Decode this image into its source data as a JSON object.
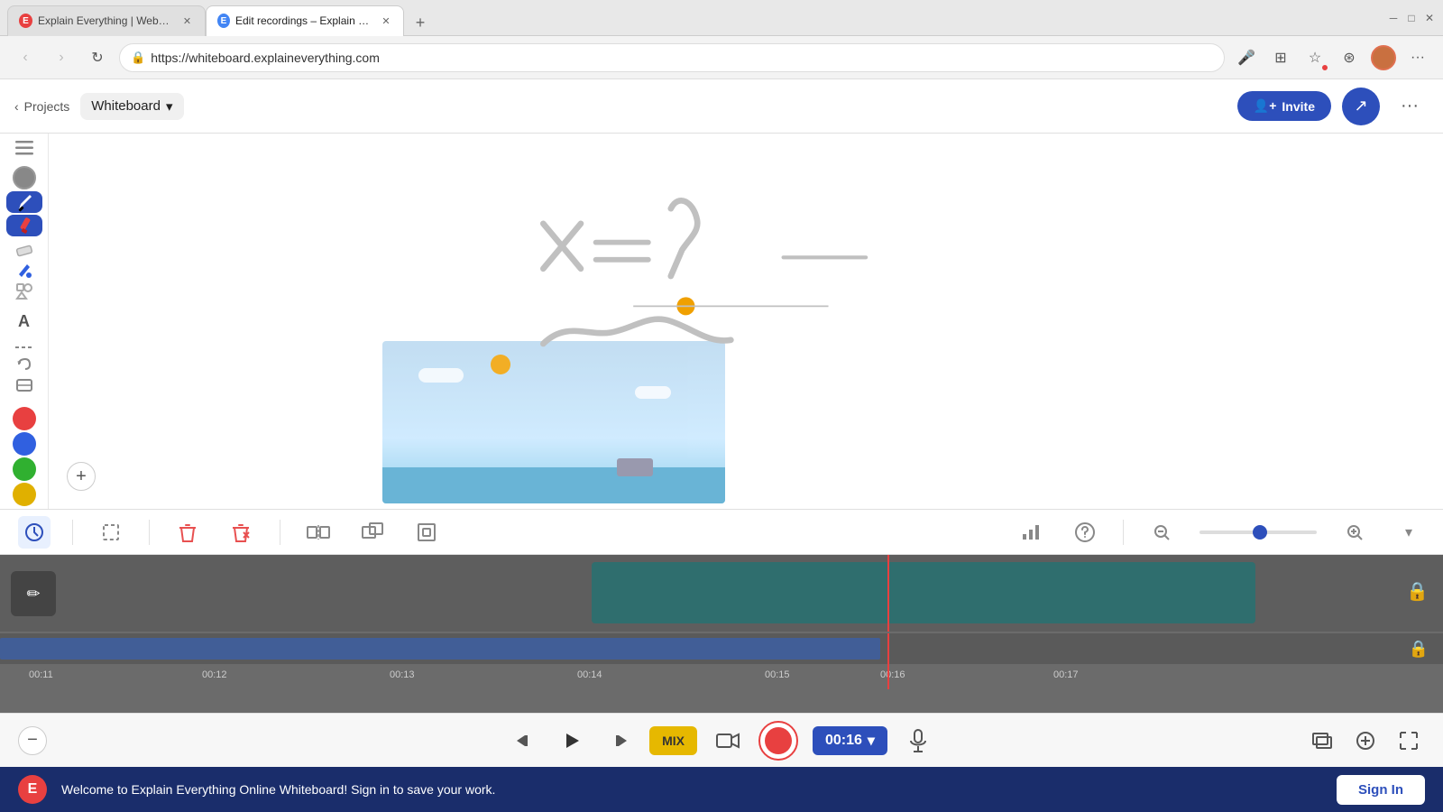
{
  "browser": {
    "tabs": [
      {
        "id": "tab1",
        "favicon_type": "ee",
        "favicon_label": "E",
        "title": "Explain Everything | Web W...",
        "active": false
      },
      {
        "id": "tab2",
        "favicon_type": "edit",
        "favicon_label": "E",
        "title": "Edit recordings – Explain Everyth...",
        "active": true
      }
    ],
    "add_tab_label": "+",
    "address": "https://whiteboard.explaineverything.com",
    "nav": {
      "back": "‹",
      "forward": "›",
      "refresh": "↻"
    },
    "win_controls": {
      "minimize": "─",
      "maximize": "□",
      "close": "✕"
    }
  },
  "app_header": {
    "back_icon": "‹",
    "projects_label": "Projects",
    "whiteboard_label": "Whiteboard",
    "dropdown_icon": "▾",
    "invite_label": "Invite",
    "invite_icon": "👤",
    "share_icon": "↗",
    "more_icon": "···"
  },
  "left_toolbar": {
    "tools": [
      {
        "id": "hamburger",
        "icon": "≡",
        "active": false
      },
      {
        "id": "select",
        "icon": "✋",
        "active": false
      },
      {
        "id": "pen",
        "icon": "✏",
        "active": false
      },
      {
        "id": "highlighter",
        "icon": "🖊",
        "active": true
      },
      {
        "id": "eraser",
        "icon": "⊘",
        "active": false
      },
      {
        "id": "fill",
        "icon": "💧",
        "active": false
      },
      {
        "id": "shapes",
        "icon": "○",
        "active": false
      },
      {
        "id": "text",
        "icon": "A",
        "active": false
      }
    ],
    "colors": [
      {
        "id": "gray",
        "value": "#888888"
      },
      {
        "id": "black-pen",
        "label": "pen",
        "selected": true
      },
      {
        "id": "red",
        "value": "#e84040"
      },
      {
        "id": "blue",
        "value": "#3060e0"
      },
      {
        "id": "green",
        "value": "#20b020"
      },
      {
        "id": "yellow",
        "value": "#e0b000"
      }
    ]
  },
  "editing_toolbar": {
    "tools": [
      {
        "id": "select-edit",
        "icon": "⊙",
        "active": true
      },
      {
        "id": "lasso",
        "icon": "⬚"
      },
      {
        "id": "delete",
        "icon": "🗑"
      },
      {
        "id": "delete-all",
        "icon": "🗑"
      },
      {
        "id": "split",
        "icon": "⊣⊢"
      },
      {
        "id": "duplicate",
        "icon": "⊞"
      },
      {
        "id": "trim",
        "icon": "◱"
      },
      {
        "id": "stats",
        "icon": "📊"
      },
      {
        "id": "help",
        "icon": "?"
      },
      {
        "id": "zoom-out",
        "icon": "—"
      },
      {
        "id": "zoom-in",
        "icon": "+"
      },
      {
        "id": "dropdown",
        "icon": "▾"
      }
    ],
    "zoom_level": 50
  },
  "timeline": {
    "current_time": "00:16",
    "markers": [
      "00:11",
      "00:12",
      "00:13",
      "00:14",
      "00:15",
      "00:16",
      "00:17"
    ],
    "playhead_position_pct": 62,
    "segment_start_pct": 40,
    "segment_end_pct": 90
  },
  "playback": {
    "rewind_icon": "⏮",
    "play_icon": "▶",
    "forward_icon": "⏭",
    "mix_label": "MIX",
    "video_icon": "🎥",
    "time": "00:16",
    "dropdown_icon": "▾",
    "mic_icon": "🎤",
    "add_scene_icon": "⊞",
    "add_btn_icon": "+",
    "fullscreen_icon": "⛶"
  },
  "bottom_banner": {
    "logo_label": "E",
    "message": "Welcome to Explain Everything Online Whiteboard! Sign in to save your work.",
    "sign_in_label": "Sign In"
  },
  "zoom_control": {
    "minus_icon": "−",
    "plus_icon": "+"
  }
}
